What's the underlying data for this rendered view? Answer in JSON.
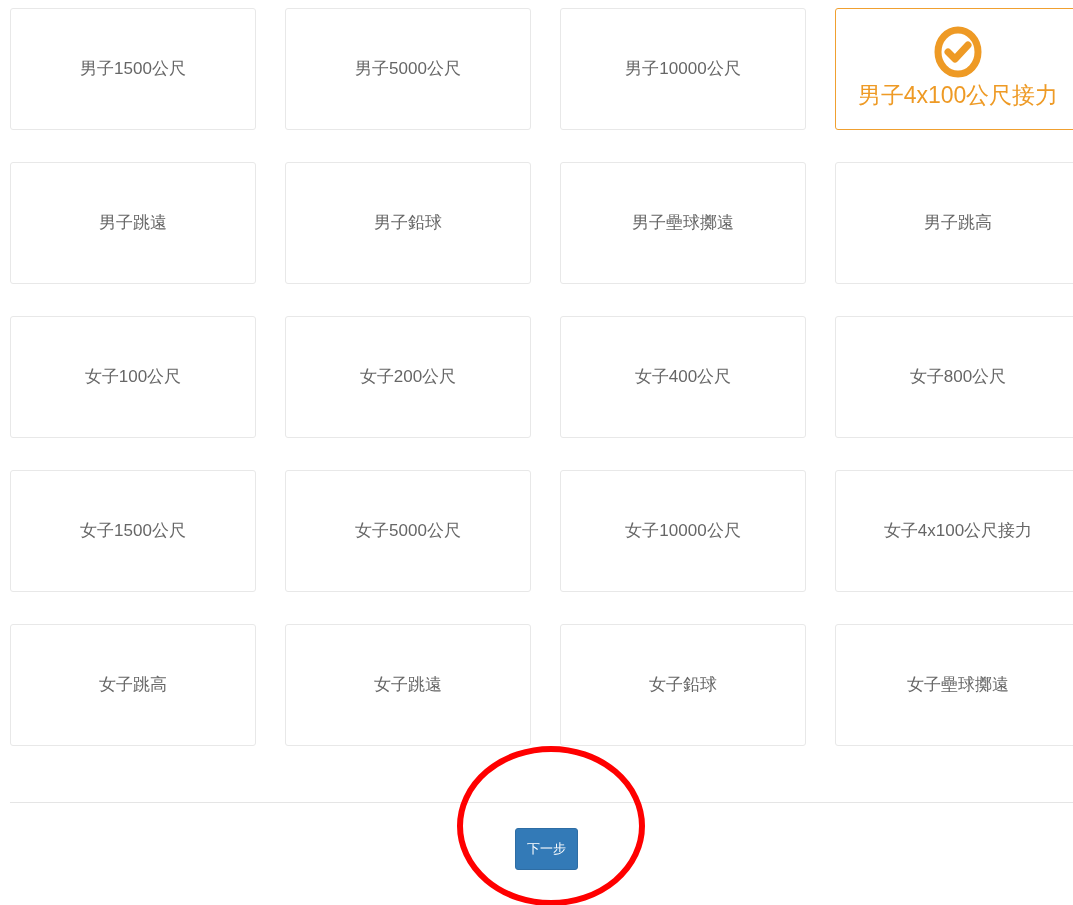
{
  "events": [
    {
      "label": "男子1500公尺",
      "selected": false
    },
    {
      "label": "男子5000公尺",
      "selected": false
    },
    {
      "label": "男子10000公尺",
      "selected": false
    },
    {
      "label": "男子4x100公尺接力",
      "selected": true
    },
    {
      "label": "男子跳遠",
      "selected": false
    },
    {
      "label": "男子鉛球",
      "selected": false
    },
    {
      "label": "男子壘球擲遠",
      "selected": false
    },
    {
      "label": "男子跳高",
      "selected": false
    },
    {
      "label": "女子100公尺",
      "selected": false
    },
    {
      "label": "女子200公尺",
      "selected": false
    },
    {
      "label": "女子400公尺",
      "selected": false
    },
    {
      "label": "女子800公尺",
      "selected": false
    },
    {
      "label": "女子1500公尺",
      "selected": false
    },
    {
      "label": "女子5000公尺",
      "selected": false
    },
    {
      "label": "女子10000公尺",
      "selected": false
    },
    {
      "label": "女子4x100公尺接力",
      "selected": false
    },
    {
      "label": "女子跳高",
      "selected": false
    },
    {
      "label": "女子跳遠",
      "selected": false
    },
    {
      "label": "女子鉛球",
      "selected": false
    },
    {
      "label": "女子壘球擲遠",
      "selected": false
    }
  ],
  "next_button": "下一步"
}
